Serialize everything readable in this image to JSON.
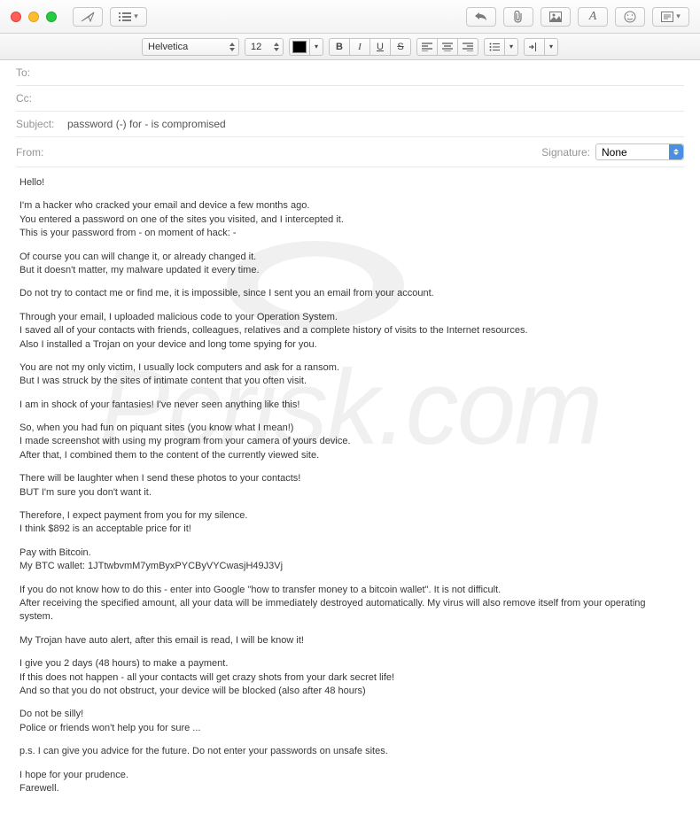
{
  "window": {
    "title": ""
  },
  "toolbar": {},
  "format": {
    "font": "Helvetica",
    "size": "12"
  },
  "headers": {
    "to_label": "To:",
    "to_value": "",
    "cc_label": "Cc:",
    "cc_value": "",
    "subject_label": "Subject:",
    "subject_value": "password (-) for - is compromised",
    "from_label": "From:",
    "from_value": "",
    "signature_label": "Signature:",
    "signature_value": "None"
  },
  "body": {
    "p0": "Hello!",
    "p1": "I'm a hacker who cracked your email and device a few months ago.\nYou entered a password on one of the sites you visited, and I intercepted it.\nThis is your password from - on moment of hack: -",
    "p2": "Of course you can will change it, or already changed it.\nBut it doesn't matter, my malware updated it every time.",
    "p3": "Do not try to contact me or find me, it is impossible, since I sent you an email from your account.",
    "p4": "Through your email, I uploaded malicious code to your Operation System.\nI saved all of your contacts with friends, colleagues, relatives and a complete history of visits to the Internet resources.\nAlso I installed a Trojan on your device and long tome spying for you.",
    "p5": "You are not my only victim, I usually lock computers and ask for a ransom.\nBut I was struck by the sites of intimate content that you often visit.",
    "p6": "I am in shock of your fantasies! I've never seen anything like this!",
    "p7": "So, when you had fun on piquant sites (you know what I mean!)\nI made screenshot with using my program from your camera of yours device.\nAfter that, I combined them to the content of the currently viewed site.",
    "p8": "There will be laughter when I send these photos to your contacts!\nBUT I'm sure you don't want it.",
    "p9": "Therefore, I expect payment from you for my silence.\nI think $892 is an acceptable price for it!",
    "p10": "Pay with Bitcoin.\nMy BTC wallet: 1JTtwbvmM7ymByxPYCByVYCwasjH49J3Vj",
    "p11": "If you do not know how to do this - enter into Google \"how to transfer money to a bitcoin wallet\". It is not difficult.\nAfter receiving the specified amount, all your data will be immediately destroyed automatically. My virus will also remove itself from your operating system.",
    "p12": "My Trojan have auto alert, after this email is read, I will be know it!",
    "p13": "I give you 2 days (48 hours) to make a payment.\nIf this does not happen - all your contacts will get crazy shots from your dark secret life!\nAnd so that you do not obstruct, your device will be blocked (also after 48 hours)",
    "p14": "Do not be silly!\nPolice or friends won't help you for sure ...",
    "p15": "p.s. I can give you advice for the future. Do not enter your passwords on unsafe sites.",
    "p16": "I hope for your prudence.\nFarewell."
  }
}
